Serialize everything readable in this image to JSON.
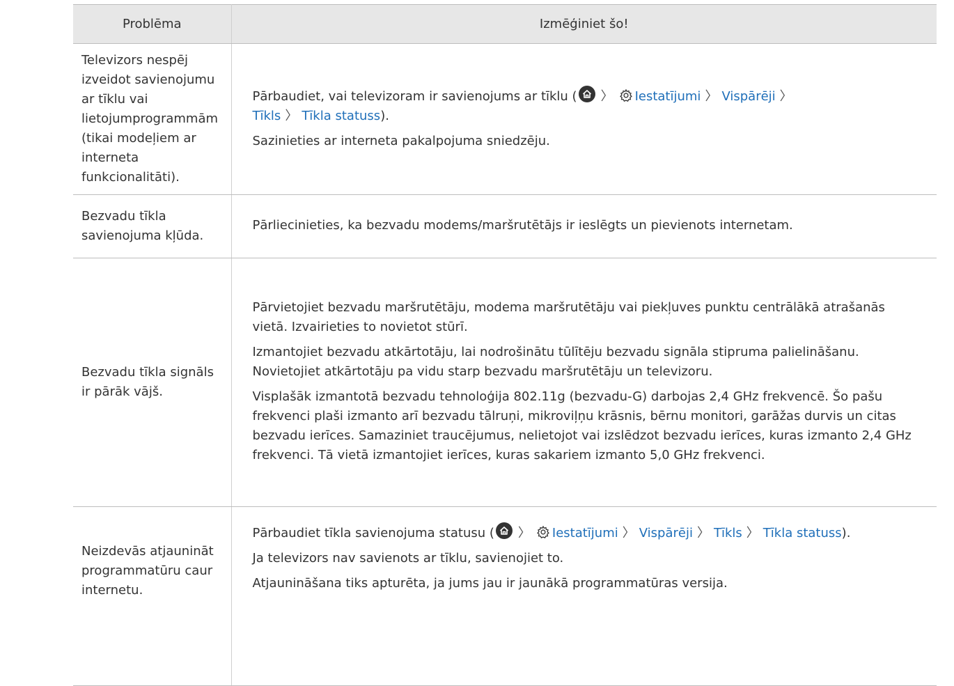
{
  "header": {
    "col1": "Problēma",
    "col2": "Izmēģiniet šo!"
  },
  "rows": [
    {
      "problem": "Televizors nespēj izveidot savienojumu ar tīklu vai lietojumprogrammām (tikai modeļiem ar interneta funkcionalitāti).",
      "sol1_pre": "Pārbaudiet, vai televizoram ir savienojums ar tīklu (",
      "path_settings": "Iestatījumi",
      "path_general": "Vispārēji",
      "path_network": "Tīkls",
      "path_status": "Tīkla statuss",
      "sol1_post": ").",
      "sol2": "Sazinieties ar interneta pakalpojuma sniedzēju."
    },
    {
      "problem": "Bezvadu tīkla savienojuma kļūda.",
      "sol1": "Pārliecinieties, ka bezvadu modems/maršrutētājs ir ieslēgts un pievienots internetam."
    },
    {
      "problem": "Bezvadu tīkla signāls ir pārāk vājš.",
      "sol1": "Pārvietojiet bezvadu maršrutētāju, modema maršrutētāju vai piekļuves punktu centrālākā atrašanās vietā. Izvairieties to novietot stūrī.",
      "sol2": "Izmantojiet bezvadu atkārtotāju, lai nodrošinātu tūlītēju bezvadu signāla stipruma palielināšanu. Novietojiet atkārtotāju pa vidu starp bezvadu maršrutētāju un televizoru.",
      "sol3": "Visplašāk izmantotā bezvadu tehnoloģija 802.11g (bezvadu-G) darbojas 2,4 GHz frekvencē. Šo pašu frekvenci plaši izmanto arī bezvadu tālruņi, mikroviļņu krāsnis, bērnu monitori, garāžas durvis un citas bezvadu ierīces. Samaziniet traucējumus, nelietojot vai izslēdzot bezvadu ierīces, kuras izmanto 2,4 GHz frekvenci. Tā vietā izmantojiet ierīces, kuras sakariem izmanto 5,0 GHz frekvenci."
    },
    {
      "problem": "Neizdevās atjaunināt programmatūru caur internetu.",
      "sol1_pre": "Pārbaudiet tīkla savienojuma statusu (",
      "path_settings": "Iestatījumi",
      "path_general": "Vispārēji",
      "path_network": "Tīkls",
      "path_status": "Tīkla statuss",
      "sol1_post": ").",
      "sol2": "Ja televizors nav savienots ar tīklu, savienojiet to.",
      "sol3": "Atjaunināšana tiks apturēta, ja jums jau ir jaunākā programmatūras versija."
    }
  ],
  "arrow_glyph": "〉",
  "colors": {
    "link": "#1f6fb9",
    "header_bg": "#e7e7e7",
    "border": "#bdbdbd",
    "text": "#333333"
  }
}
